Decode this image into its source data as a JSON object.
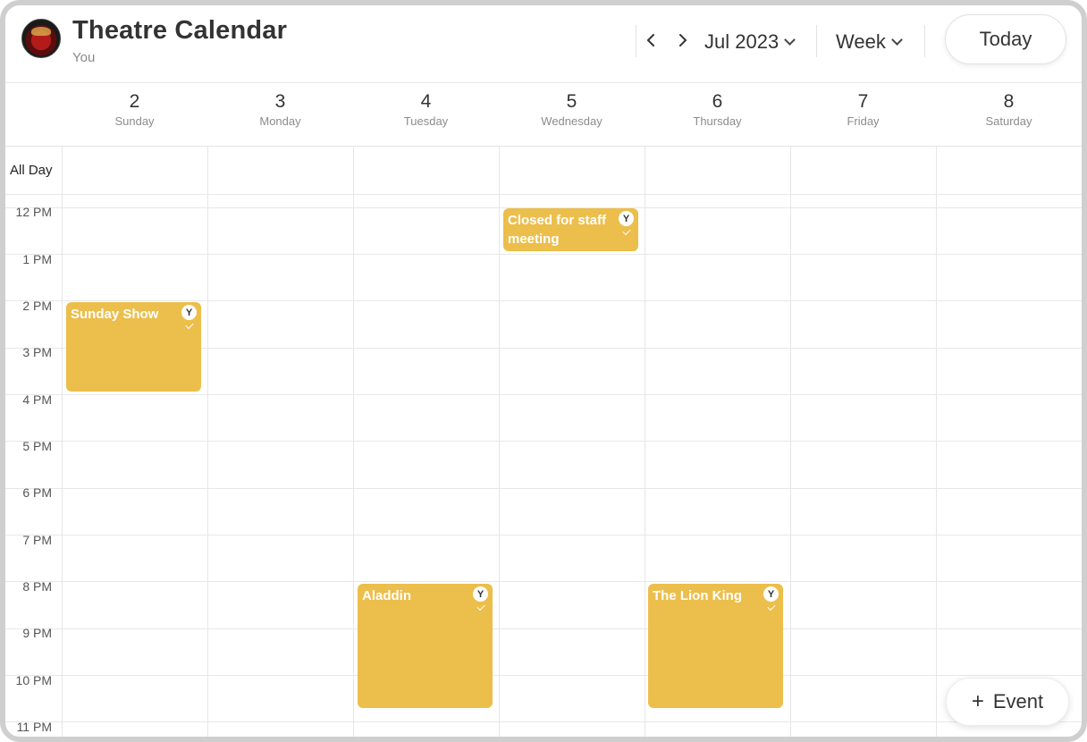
{
  "header": {
    "title": "Theatre Calendar",
    "subtitle": "You",
    "prev_icon": "chevron-left-icon",
    "next_icon": "chevron-right-icon",
    "month_label": "Jul 2023",
    "view_label": "Week",
    "today_label": "Today"
  },
  "days": [
    {
      "num": "2",
      "name": "Sunday"
    },
    {
      "num": "3",
      "name": "Monday"
    },
    {
      "num": "4",
      "name": "Tuesday"
    },
    {
      "num": "5",
      "name": "Wednesday"
    },
    {
      "num": "6",
      "name": "Thursday"
    },
    {
      "num": "7",
      "name": "Friday"
    },
    {
      "num": "8",
      "name": "Saturday"
    }
  ],
  "allday_label": "All Day",
  "time_labels": [
    "12 PM",
    "1 PM",
    "2 PM",
    "3 PM",
    "4 PM",
    "5 PM",
    "6 PM",
    "7 PM",
    "8 PM",
    "9 PM",
    "10 PM",
    "11 PM"
  ],
  "events": [
    {
      "title": "Sunday Show",
      "badge": "Y"
    },
    {
      "title": "Closed for staff meeting",
      "badge": "Y"
    },
    {
      "title": "Aladdin",
      "badge": "Y"
    },
    {
      "title": "The Lion King",
      "badge": "Y"
    }
  ],
  "add_event": {
    "plus": "+",
    "label": "Event"
  },
  "colors": {
    "event": "#ecbe4b",
    "grid_line": "#e6e6e6"
  }
}
